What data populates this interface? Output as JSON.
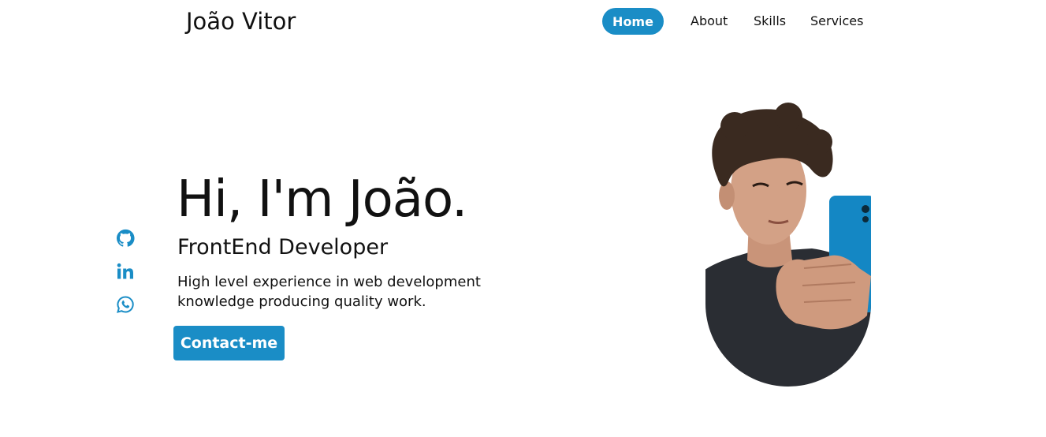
{
  "header": {
    "logo": "João Vitor",
    "nav": [
      {
        "label": "Home",
        "active": true
      },
      {
        "label": "About",
        "active": false
      },
      {
        "label": "Skills",
        "active": false
      },
      {
        "label": "Services",
        "active": false
      }
    ]
  },
  "socials": [
    {
      "icon": "github-icon"
    },
    {
      "icon": "linkedin-icon"
    },
    {
      "icon": "whatsapp-icon"
    }
  ],
  "hero": {
    "title": "Hi, I'm João.",
    "subtitle": "FrontEnd Developer",
    "description_line1": "High level experience in web development",
    "description_line2": "knowledge producing quality work.",
    "button_label": "Contact-me"
  },
  "colors": {
    "accent": "#1a8dc6",
    "text": "#111111",
    "background": "#ffffff"
  }
}
